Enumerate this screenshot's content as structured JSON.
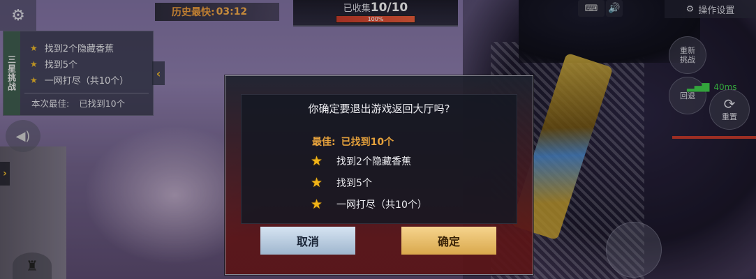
{
  "hud": {
    "record_label": "历史最快:",
    "record_value": "03:12",
    "collect_label": "已收集",
    "collect_value": "10/10",
    "progress_text": "100%",
    "progress_fraction": 1.0,
    "op_settings": "操作设置"
  },
  "challenge_panel": {
    "title": "三星挑战",
    "items": [
      {
        "label": "找到2个隐藏香蕉"
      },
      {
        "label": "找到5个"
      },
      {
        "label": "一网打尽（共10个）"
      }
    ],
    "best_label": "本次最佳:",
    "best_value": "已找到10个"
  },
  "controls": {
    "restart": "重新挑战",
    "back": "回退",
    "reset": "重置",
    "ping": "40ms"
  },
  "dialog": {
    "question": "你确定要退出游戏返回大厅吗?",
    "best_label": "最佳:",
    "best_value": "已找到10个",
    "items": [
      {
        "label": "找到2个隐藏香蕉"
      },
      {
        "label": "找到5个"
      },
      {
        "label": "一网打尽（共10个）"
      }
    ],
    "cancel": "取消",
    "confirm": "确定"
  },
  "colors": {
    "accent_gold": "#e6a23c",
    "star": "#f2b418",
    "progress": "#d54a32"
  },
  "icons": [
    "gear-icon",
    "keyboard-icon",
    "speaker-icon",
    "settings-gear-icon",
    "star-icon",
    "chevron-left-icon",
    "chevron-right-icon",
    "reset-icon",
    "signal-icon",
    "voice-icon",
    "soldier-icon"
  ]
}
